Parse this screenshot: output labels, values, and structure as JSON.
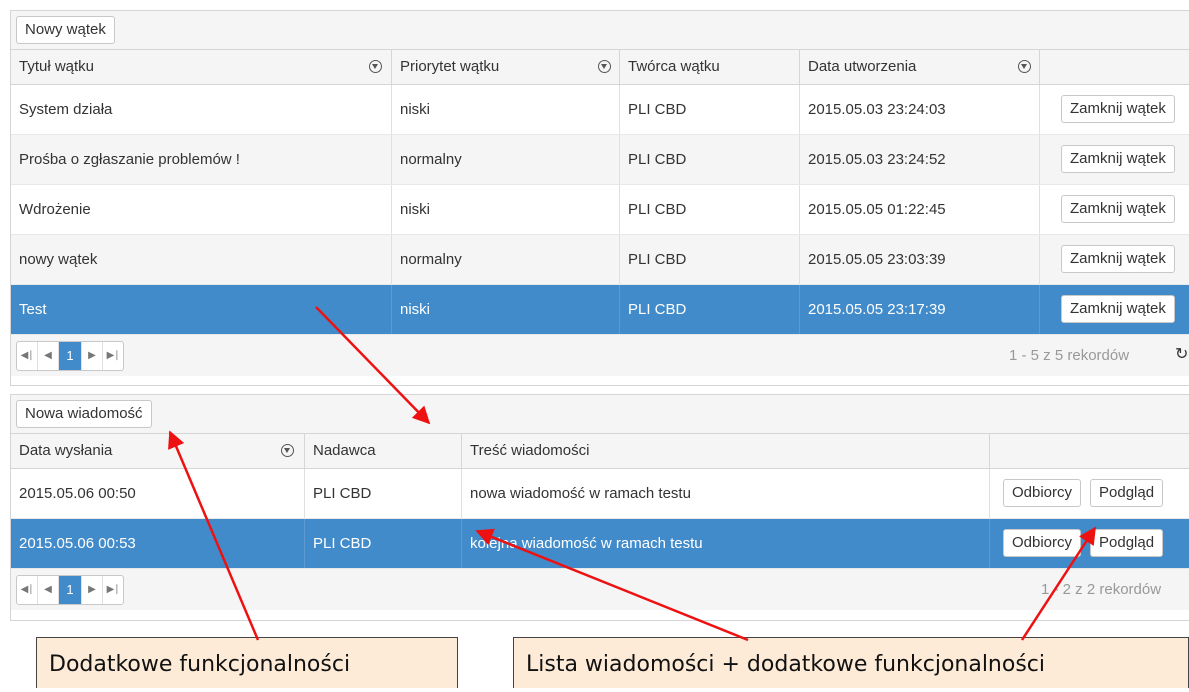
{
  "threads": {
    "new_button": "Nowy wątek",
    "columns": [
      "Tytuł wątku",
      "Priorytet wątku",
      "Twórca wątku",
      "Data utworzenia"
    ],
    "rows": [
      {
        "title": "System działa",
        "priority": "niski",
        "creator": "PLI CBD",
        "created": "2015.05.03 23:24:03",
        "action": "Zamknij wątek"
      },
      {
        "title": "Prośba o zgłaszanie problemów !",
        "priority": "normalny",
        "creator": "PLI CBD",
        "created": "2015.05.03 23:24:52",
        "action": "Zamknij wątek"
      },
      {
        "title": "Wdrożenie",
        "priority": "niski",
        "creator": "PLI CBD",
        "created": "2015.05.05 01:22:45",
        "action": "Zamknij wątek"
      },
      {
        "title": "nowy wątek",
        "priority": "normalny",
        "creator": "PLI CBD",
        "created": "2015.05.05 23:03:39",
        "action": "Zamknij wątek"
      },
      {
        "title": "Test",
        "priority": "niski",
        "creator": "PLI CBD",
        "created": "2015.05.05 23:17:39",
        "action": "Zamknij wątek"
      }
    ],
    "pager": {
      "current_page": "1",
      "count": "1 - 5 z 5 rekordów"
    }
  },
  "messages": {
    "new_button": "Nowa wiadomość",
    "columns": [
      "Data wysłania",
      "Nadawca",
      "Treść wiadomości"
    ],
    "rows": [
      {
        "sent": "2015.05.06 00:50",
        "sender": "PLI CBD",
        "content": "nowa wiadomość w ramach testu",
        "recipients": "Odbiorcy",
        "preview": "Podgląd"
      },
      {
        "sent": "2015.05.06 00:53",
        "sender": "PLI CBD",
        "content": "kolejna wiadomość w ramach testu",
        "recipients": "Odbiorcy",
        "preview": "Podgląd"
      }
    ],
    "pager": {
      "current_page": "1",
      "count": "1 - 2 z 2 rekordów"
    }
  },
  "annotations": {
    "left": "Dodatkowe funkcjonalności",
    "right": "Lista wiadomości + dodatkowe funkcjonalności"
  },
  "colors": {
    "selected_row": "#428bca",
    "arrow": "#ee1111",
    "callout_bg": "#fdebd8"
  },
  "icons": [
    "filter-icon",
    "first-page-icon",
    "prev-page-icon",
    "next-page-icon",
    "last-page-icon",
    "refresh-icon"
  ]
}
